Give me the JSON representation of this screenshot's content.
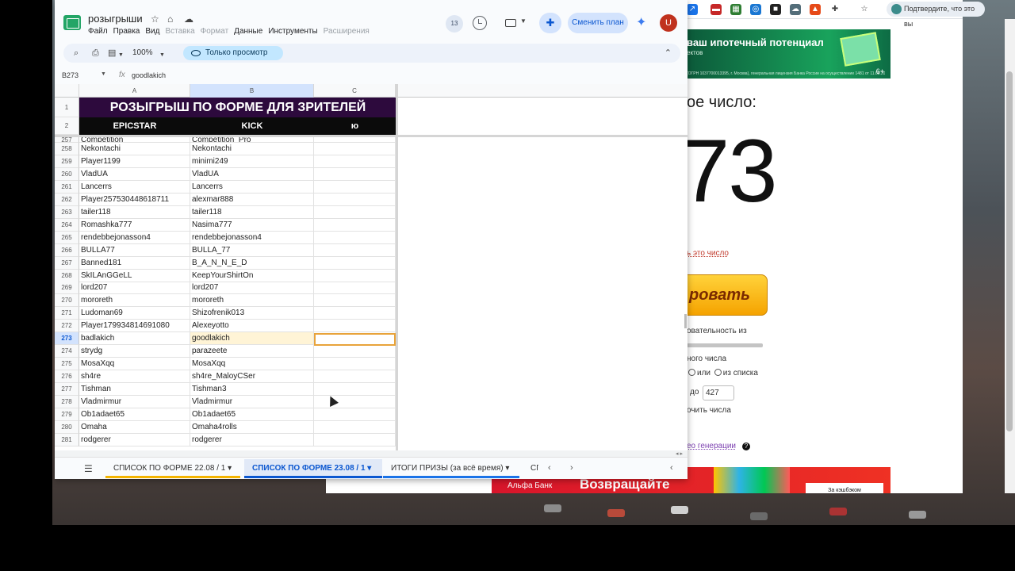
{
  "sheets_app": {
    "doc_title": "розыгрыши",
    "menu": [
      {
        "label": "Файл",
        "dim": false
      },
      {
        "label": "Правка",
        "dim": false
      },
      {
        "label": "Вид",
        "dim": false
      },
      {
        "label": "Вставка",
        "dim": true
      },
      {
        "label": "Формат",
        "dim": true
      },
      {
        "label": "Данные",
        "dim": false
      },
      {
        "label": "Инструменты",
        "dim": false
      },
      {
        "label": "Расширения",
        "dim": true
      }
    ],
    "version_count": "13",
    "upgrade_label": "Сменить план",
    "avatar_letter": "U",
    "zoom": "100%",
    "view_only_label": "Только просмотр",
    "name_box": "B273",
    "formula_value": "goodlakich",
    "columns": [
      "A",
      "B",
      "C"
    ],
    "title_row": {
      "row": "1",
      "text": "РОЗЫГРЫШ ПО ФОРМЕ ДЛЯ ЗРИТЕЛЕЙ"
    },
    "header_row": {
      "row": "2",
      "a": "EPICSTAR",
      "b": "KICK",
      "c": "ю"
    },
    "partial_top": {
      "row": "257",
      "a": "Competition",
      "b": "Competition_Pro"
    },
    "rows": [
      {
        "n": "258",
        "a": "Nekontachi",
        "b": "Nekontachi"
      },
      {
        "n": "259",
        "a": "Player1199",
        "b": "minimi249"
      },
      {
        "n": "260",
        "a": "VladUA",
        "b": "VladUA"
      },
      {
        "n": "261",
        "a": "Lancerrs",
        "b": "Lancerrs"
      },
      {
        "n": "262",
        "a": "Player257530448618711",
        "b": "alexmar888"
      },
      {
        "n": "263",
        "a": "tailer118",
        "b": "tailer118"
      },
      {
        "n": "264",
        "a": "Romashka777",
        "b": "Nasima777"
      },
      {
        "n": "265",
        "a": "rendebbejonasson4",
        "b": "rendebbejonasson4"
      },
      {
        "n": "266",
        "a": "BULLA77",
        "b": "BULLA_77"
      },
      {
        "n": "267",
        "a": "Banned181",
        "b": "B_A_N_N_E_D"
      },
      {
        "n": "268",
        "a": "SkILAnGGeLL",
        "b": "KeepYourShirtOn"
      },
      {
        "n": "269",
        "a": "lord207",
        "b": "lord207"
      },
      {
        "n": "270",
        "a": "mororeth",
        "b": "mororeth"
      },
      {
        "n": "271",
        "a": "Ludoman69",
        "b": "Shizofrenik013"
      },
      {
        "n": "272",
        "a": "Player179934814691080",
        "b": "Alexeyotto"
      },
      {
        "n": "273",
        "a": "badlakich",
        "b": "goodlakich"
      },
      {
        "n": "274",
        "a": "strydg",
        "b": "parazeete"
      },
      {
        "n": "275",
        "a": "MosaXqq",
        "b": "MosaXqq"
      },
      {
        "n": "276",
        "a": "sh4re",
        "b": "sh4re_MaloyCSer"
      },
      {
        "n": "277",
        "a": "Tishman",
        "b": "Tishman3"
      },
      {
        "n": "278",
        "a": "Vladmirmur",
        "b": "Vladmirmur"
      },
      {
        "n": "279",
        "a": "Ob1adaet65",
        "b": "Ob1adaet65"
      },
      {
        "n": "280",
        "a": "Omaha",
        "b": "Omaha4rolls"
      },
      {
        "n": "281",
        "a": "rodgerer",
        "b": "rodgerer"
      }
    ],
    "sheet_tabs": [
      {
        "label": "СПИСОК ПО ФОРМЕ 22.08 / 1",
        "active": false
      },
      {
        "label": "СПИСОК ПО ФОРМЕ 23.08 / 1",
        "active": true
      },
      {
        "label": "ИТОГИ ПРИЗЫ (за всё время)",
        "active": false
      },
      {
        "label": "СГ",
        "active": false
      }
    ]
  },
  "browser_page": {
    "verify_label": "Подтвердите, что это вы",
    "ad_top_title": "ваш ипотечный потенциал",
    "ad_top_sub": "ектов",
    "ad_top_small": "(ОГРН 1037700013395, г. Москва), генеральная лицензия Банка России на осуществление 1481 от 11.08.2015 г. Услуги domclick.ru предоставляет ООО «Домклик» (ОГРН 1157746652150, г. Москва).",
    "ad_top_age": "6+",
    "result_label": "ое число:",
    "result_number": "73",
    "copy_link": "ь это число",
    "generate_label": "ровать",
    "sequence_label": "овательность из",
    "unique_label": "ного числа",
    "mode_or": "или",
    "mode_list": "из списка",
    "range_to": "до",
    "range_max": "427",
    "exclude_label": "очить числа",
    "video_link": "ео генерации",
    "ad_bottom_bank": "Альфа Банк",
    "ad_bottom_slogan": "Возвращайте",
    "ad_bottom_cta": "За кэшбэком"
  },
  "colors": {
    "title_band": "#2d0a3d",
    "header_band": "#0b0b0b",
    "selection": "#e8a33a",
    "active_tab": "#0b57d0",
    "generate_button": "#f5a300"
  }
}
